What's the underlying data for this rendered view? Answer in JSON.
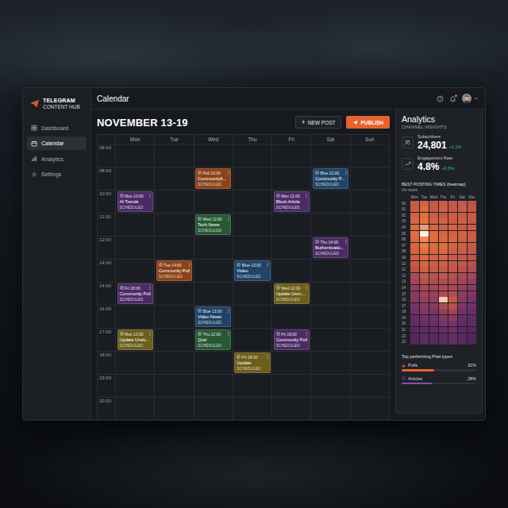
{
  "logo": {
    "title": "TELEGRAM",
    "subtitle": "CONTENT HUB"
  },
  "sidebar": {
    "items": [
      {
        "label": "Dashboard",
        "selected": false
      },
      {
        "label": "Calendar",
        "selected": true
      },
      {
        "label": "Analytics",
        "selected": false
      },
      {
        "label": "Settings",
        "selected": false
      }
    ]
  },
  "topbar": {
    "title": "Calendar",
    "notifications": {
      "unread": true
    }
  },
  "calendar": {
    "heading": "NOVEMBER 13-19",
    "buttons": [
      {
        "icon": "+",
        "label": "NEW POST",
        "kind": "secondary"
      },
      {
        "icon": "",
        "label": "PUBLISH",
        "kind": "primary"
      }
    ],
    "days": [
      "Mon",
      "Tue",
      "Wed",
      "Thu",
      "Fri",
      "Sat",
      "Sun"
    ],
    "rows": [
      {
        "time": "08:00",
        "events": []
      },
      {
        "time": "08:00",
        "events": [
          {
            "day": "Wed",
            "tag": "Poll 10:00",
            "title": "CommunityIt...",
            "status": "SCHEDULED",
            "color": "#8c4318"
          },
          {
            "day": "Sat",
            "tag": "Blue 12:00",
            "title": "Community P...",
            "status": "SCHEDULED",
            "color": "#1e4468"
          }
        ]
      },
      {
        "time": "10:00",
        "events": [
          {
            "day": "Mon",
            "tag": "Mon 10:00",
            "title": "AI Trends",
            "status": "SCHEDULED",
            "color": "#4b2b66"
          },
          {
            "day": "Fri",
            "tag": "Mon 12:00",
            "title": "Block Article",
            "status": "SCHEDULED",
            "color": "#4b2b66"
          }
        ]
      },
      {
        "time": "11:00",
        "events": [
          {
            "day": "Wed",
            "tag": "Wed 12:00",
            "title": "Tech News",
            "status": "SCHEDULED",
            "color": "#275a33"
          }
        ]
      },
      {
        "time": "12:00",
        "events": [
          {
            "day": "Sat",
            "tag": "Thu 14:00",
            "title": "Buthenticatio...",
            "status": "SCHEDULED",
            "color": "#4b2b66"
          }
        ]
      },
      {
        "time": "14:00",
        "events": [
          {
            "day": "Tue",
            "tag": "Tue 14:00",
            "title": "Community Poll",
            "status": "SCHEDULED",
            "color": "#8c4318"
          },
          {
            "day": "Thu",
            "tag": "Blue 13:00",
            "title": "Video",
            "status": "SCHEDULED",
            "color": "#1e4468"
          }
        ]
      },
      {
        "time": "14:00",
        "events": [
          {
            "day": "Mon",
            "tag": "Fri 18:00",
            "title": "Community Poll",
            "status": "SCHEDULED",
            "color": "#4b2b66"
          },
          {
            "day": "Fri",
            "tag": "Wed 12:00",
            "title": "Update Unm...",
            "status": "SCHEDULED",
            "color": "#6b5f1a"
          }
        ]
      },
      {
        "time": "16:00",
        "events": [
          {
            "day": "Wed",
            "tag": "Blue 13:00",
            "title": "Video News",
            "status": "SCHEDULED",
            "color": "#1e4468"
          }
        ]
      },
      {
        "time": "17:00",
        "events": [
          {
            "day": "Mon",
            "tag": "Mon 12:00",
            "title": "Update Undo...",
            "status": "SCHEDULED",
            "color": "#6b5f1a"
          },
          {
            "day": "Wed",
            "tag": "Thu 12:00",
            "title": "Quiz",
            "status": "SCHEDULED",
            "color": "#275a33"
          },
          {
            "day": "Fri",
            "tag": "Fri 18:00",
            "title": "Community Poll",
            "status": "SCHEDULED",
            "color": "#4b2b66"
          }
        ]
      },
      {
        "time": "18:00",
        "events": [
          {
            "day": "Thu",
            "tag": "Fri 18:00",
            "title": "Update",
            "status": "SCHEDULED",
            "color": "#6b5f1a"
          }
        ]
      },
      {
        "time": "19:00",
        "events": []
      },
      {
        "time": "20:00",
        "events": []
      }
    ]
  },
  "analytics": {
    "title": "Analytics",
    "subtitle": "CHANNEL INSIGHTS",
    "stats": [
      {
        "kind": "subscribers",
        "label": "Subscribers",
        "value": "24,801",
        "change": "+1.2%"
      },
      {
        "kind": "engagement",
        "label": "Engagement Rate",
        "value": "4.8%",
        "change": "+0.5%"
      }
    ],
    "heatmap": {
      "title": "BEST POSTING TIMES (heatmap)",
      "subtitle": "the week",
      "days": [
        "Mon",
        "Tue",
        "Wed",
        "Thu",
        "Fri",
        "Sat",
        "Sun"
      ],
      "hours": [
        "00",
        "01",
        "02",
        "03",
        "04",
        "05",
        "06",
        "07",
        "08",
        "09",
        "10",
        "11",
        "12",
        "13",
        "14",
        "15",
        "16",
        "17",
        "18",
        "19",
        "20",
        "21",
        "22",
        "23"
      ],
      "values": [
        [
          0.7,
          0.75,
          0.7,
          0.72,
          0.68,
          0.7,
          0.65
        ],
        [
          0.72,
          0.8,
          0.7,
          0.75,
          0.7,
          0.72,
          0.68
        ],
        [
          0.75,
          0.82,
          0.72,
          0.7,
          0.74,
          0.7,
          0.7
        ],
        [
          0.78,
          0.85,
          0.75,
          0.76,
          0.72,
          0.74,
          0.7
        ],
        [
          0.8,
          0.9,
          0.78,
          0.74,
          0.76,
          0.72,
          0.72
        ],
        [
          0.82,
          1,
          0.8,
          0.78,
          0.75,
          0.76,
          0.7
        ],
        [
          0.8,
          0.88,
          0.82,
          0.8,
          0.78,
          0.74,
          0.72
        ],
        [
          0.78,
          0.86,
          0.8,
          0.82,
          0.76,
          0.75,
          0.7
        ],
        [
          0.76,
          0.84,
          0.78,
          0.8,
          0.74,
          0.72,
          0.68
        ],
        [
          0.72,
          0.8,
          0.75,
          0.76,
          0.72,
          0.7,
          0.66
        ],
        [
          0.7,
          0.78,
          0.72,
          0.74,
          0.7,
          0.68,
          0.64
        ],
        [
          0.66,
          0.74,
          0.7,
          0.7,
          0.68,
          0.64,
          0.6
        ],
        [
          0.6,
          0.7,
          0.66,
          0.68,
          0.64,
          0.6,
          0.56
        ],
        [
          0.55,
          0.64,
          0.6,
          0.62,
          0.6,
          0.55,
          0.5
        ],
        [
          0.5,
          0.58,
          0.56,
          0.6,
          0.58,
          0.5,
          0.46
        ],
        [
          0.46,
          0.55,
          0.52,
          0.6,
          0.62,
          0.48,
          0.42
        ],
        [
          0.44,
          0.5,
          0.5,
          0.95,
          0.7,
          0.46,
          0.4
        ],
        [
          0.4,
          0.46,
          0.46,
          0.6,
          0.64,
          0.42,
          0.38
        ],
        [
          0.36,
          0.42,
          0.4,
          0.5,
          0.55,
          0.38,
          0.34
        ],
        [
          0.32,
          0.38,
          0.36,
          0.44,
          0.46,
          0.34,
          0.3
        ],
        [
          0.3,
          0.34,
          0.32,
          0.4,
          0.4,
          0.3,
          0.28
        ],
        [
          0.26,
          0.3,
          0.3,
          0.34,
          0.36,
          0.28,
          0.25
        ],
        [
          0.24,
          0.28,
          0.26,
          0.3,
          0.32,
          0.26,
          0.22
        ],
        [
          0.22,
          0.26,
          0.24,
          0.28,
          0.3,
          0.24,
          0.2
        ]
      ]
    },
    "post_types": {
      "title": "Top performing Post types",
      "items": [
        {
          "label": "Polls",
          "value": "32%",
          "level": 0.44,
          "color": "#e8622c"
        },
        {
          "label": "Articles",
          "value": "28%",
          "level": 0.4,
          "color": "#8e4bb5"
        }
      ]
    }
  }
}
